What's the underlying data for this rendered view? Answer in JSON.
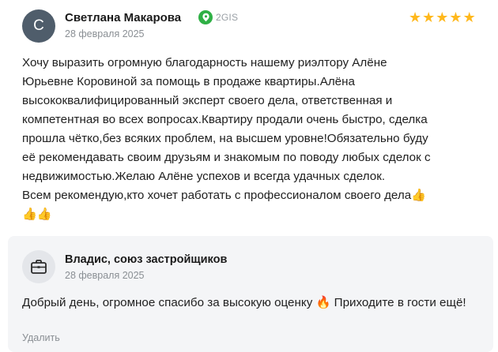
{
  "review": {
    "avatar_letter": "С",
    "author": "Светлана Макарова",
    "source": "2GIS",
    "date": "28 февраля 2025",
    "rating": 5,
    "text": "Хочу выразить огромную благодарность нашему риэлтору Алёне\nЮрьевне Коровиной за помощь в продаже квартиры.Алёна\nвысококвалифицированный эксперт своего дела, ответственная и\nкомпетентная во всех вопросах.Квартиру продали очень быстро, сделка\nпрошла чётко,без всяких проблем, на высшем уровне!Обязательно буду\nеё рекомендавать своим друзьям и знакомым по поводу любых сделок с\nнедвижимостью.Желаю Алёне успехов и всегда удачных сделок.\nВсем рекомендую,кто хочет работать с профессионалом своего дела👍\n👍👍"
  },
  "reply": {
    "author": "Владис, союз застройщиков",
    "date": "28 февраля 2025",
    "text": "Добрый день, огромное спасибо за высокую оценку 🔥 Приходите в гости ещё!",
    "delete_label": "Удалить"
  },
  "colors": {
    "avatar_bg": "#4f5d6b",
    "star": "#ffb81c",
    "source_icon": "#2fb045",
    "reply_bg": "#f4f5f7"
  },
  "icons": {
    "source": "2gis-leaf-icon",
    "reply_avatar": "briefcase-icon",
    "star": "star-icon"
  }
}
